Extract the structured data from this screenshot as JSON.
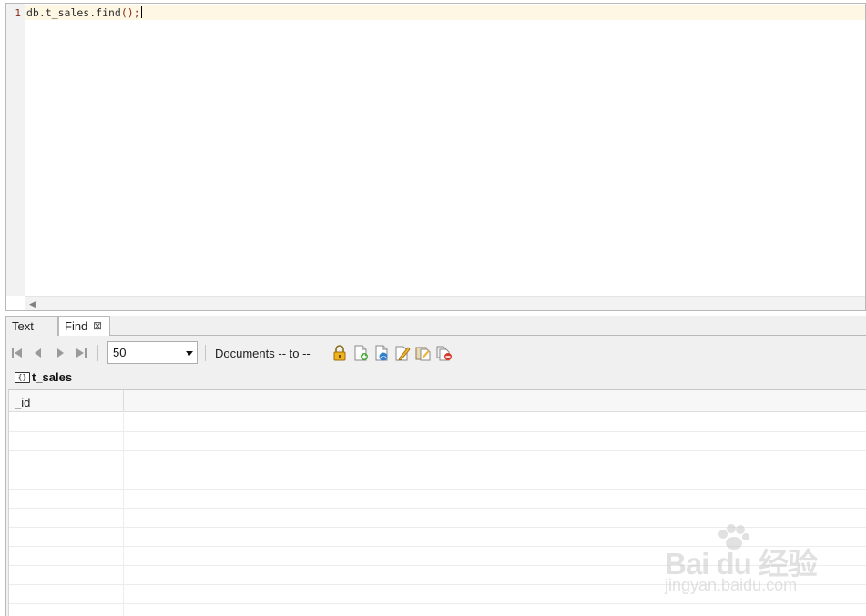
{
  "editor": {
    "line_number": "1",
    "code_object": "db.t_sales.find",
    "code_parens": "();"
  },
  "tabs": [
    {
      "label": "Text",
      "active": false
    },
    {
      "label": "Find",
      "active": true,
      "close_glyph": "⊠"
    }
  ],
  "toolbar": {
    "nav_icons": [
      "first-page-icon",
      "prev-page-icon",
      "next-page-icon",
      "last-page-icon"
    ],
    "page_size": "50",
    "documents_range": "Documents -- to --",
    "action_icons": [
      "lock-icon",
      "add-document-icon",
      "view-document-icon",
      "edit-document-icon",
      "paste-document-icon",
      "delete-document-icon"
    ]
  },
  "result": {
    "collection_icon": "{}",
    "collection_name": "t_sales",
    "columns": [
      "_id"
    ]
  },
  "watermark": {
    "brand": "Bai du 经验",
    "site": "jingyan.baidu.com"
  },
  "colors": {
    "line_number": "#8a2b1a",
    "active_line": "#fdf7e4",
    "panel_bg": "#f0f0f0"
  }
}
